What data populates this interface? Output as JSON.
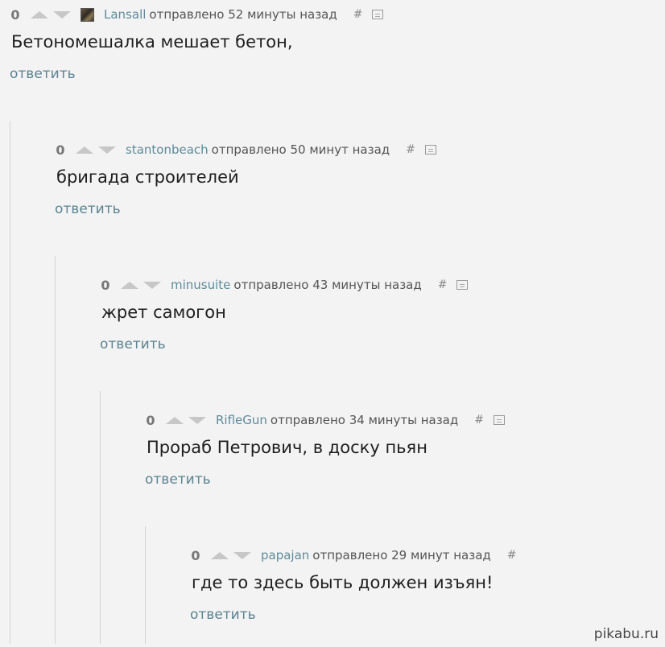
{
  "comments": [
    {
      "score": "0",
      "author": "Lansall",
      "posted": "отправлено 52 минуты назад",
      "permalink": "#",
      "body": "Бетономешалка мешает бетон,",
      "reply": "ответить",
      "has_avatar": true
    },
    {
      "score": "0",
      "author": "stantonbeach",
      "posted": "отправлено 50 минут назад",
      "permalink": "#",
      "body": "бригада строителей",
      "reply": "ответить"
    },
    {
      "score": "0",
      "author": "minusuite",
      "posted": "отправлено 43 минуты назад",
      "permalink": "#",
      "body": "жрет самогон",
      "reply": "ответить"
    },
    {
      "score": "0",
      "author": "RifleGun",
      "posted": "отправлено 34 минуты назад",
      "permalink": "#",
      "body": "Прораб Петрович, в доску пьян",
      "reply": "ответить"
    },
    {
      "score": "0",
      "author": "papajan",
      "posted": "отправлено 29 минут назад",
      "permalink": "#",
      "body": "где то здесь быть должен изъян!",
      "reply": "ответить"
    }
  ],
  "watermark": "pikabu.ru",
  "colors": {
    "background": "#f3f3f3",
    "author": "#5f8a9a",
    "reply_link": "#5c8391",
    "vote_arrow": "#c7c7c7"
  },
  "icons": {
    "vote_up": "triangle-up-icon",
    "vote_down": "triangle-down-icon",
    "permalink": "hash-icon",
    "reply": "reply-box-icon"
  }
}
